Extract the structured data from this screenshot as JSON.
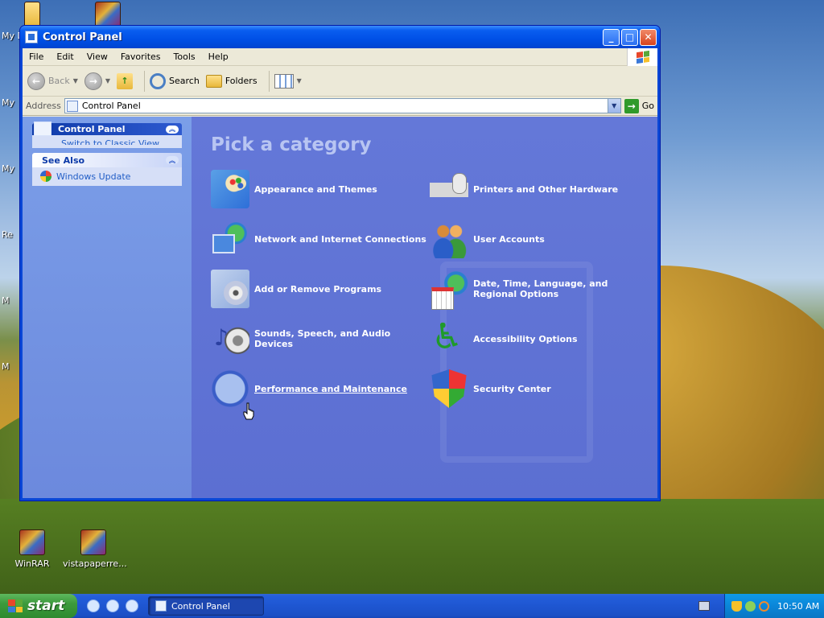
{
  "desktop": {
    "edge_labels": [
      "My D",
      "My",
      "My",
      "Re",
      "M",
      "M"
    ],
    "icons": [
      {
        "name": "winrar-shortcut",
        "label": "WinRAR"
      },
      {
        "name": "vistapaperre-archive",
        "label": "vistapaperre..."
      }
    ]
  },
  "window": {
    "title": "Control Panel",
    "buttons": {
      "minimize": "_",
      "maximize": "□",
      "close": "✕"
    }
  },
  "menu": [
    "File",
    "Edit",
    "View",
    "Favorites",
    "Tools",
    "Help"
  ],
  "toolbar": {
    "back_label": "Back",
    "search_label": "Search",
    "folders_label": "Folders"
  },
  "address": {
    "label": "Address",
    "value": "Control Panel",
    "go_label": "Go"
  },
  "taskpane": {
    "control_panel_title": "Control Panel",
    "switch_view_link": "Switch to Classic View",
    "see_also_title": "See Also",
    "windows_update_link": "Windows Update"
  },
  "main": {
    "heading": "Pick a category",
    "categories": [
      {
        "label": "Appearance and Themes",
        "icon": "appearance-themes-icon"
      },
      {
        "label": "Printers and Other Hardware",
        "icon": "printer-icon"
      },
      {
        "label": "Network and Internet Connections",
        "icon": "network-icon"
      },
      {
        "label": "User Accounts",
        "icon": "user-accounts-icon"
      },
      {
        "label": "Add or Remove Programs",
        "icon": "add-remove-programs-icon"
      },
      {
        "label": "Date, Time, Language, and Regional Options",
        "icon": "date-time-icon"
      },
      {
        "label": "Sounds, Speech, and Audio Devices",
        "icon": "sounds-icon"
      },
      {
        "label": "Accessibility Options",
        "icon": "accessibility-icon"
      },
      {
        "label": "Performance and Maintenance",
        "icon": "performance-icon",
        "hovered": true
      },
      {
        "label": "Security Center",
        "icon": "security-shield-icon"
      }
    ]
  },
  "taskbar": {
    "start_label": "start",
    "task_button": "Control Panel",
    "clock": "10:50 AM"
  },
  "colors": {
    "title_blue": "#0050e6",
    "category_panel": "#6478d8",
    "start_green": "#3c9a3c"
  }
}
